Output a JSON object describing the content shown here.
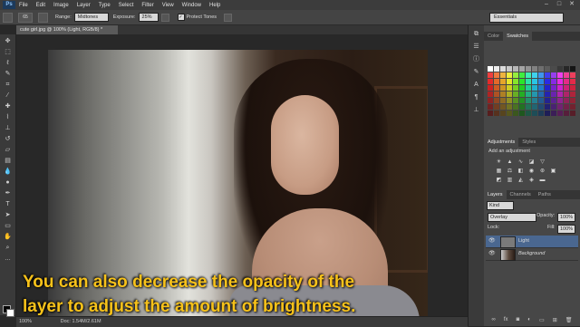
{
  "app": {
    "logo": "Ps",
    "menu": [
      "File",
      "Edit",
      "Image",
      "Layer",
      "Type",
      "Select",
      "Filter",
      "View",
      "Window",
      "Help"
    ]
  },
  "options": {
    "brush_size": "65",
    "range_label": "Range:",
    "range_value": "Midtones",
    "exposure_label": "Exposure:",
    "exposure_value": "25%",
    "protect_label": "Protect Tones",
    "workspace": "Essentials"
  },
  "document": {
    "tab": "cute girl.jpg @ 100% (Light, RGB/8) *",
    "zoom": "100%",
    "doc_info": "Doc: 1.54M/2.61M"
  },
  "caption": {
    "line1": "You can also decrease the opacity of the",
    "line2": "layer to adjust the amount of brightness."
  },
  "panels": {
    "color_tabs": [
      "Color",
      "Swatches"
    ],
    "adjust_tabs": [
      "Adjustments",
      "Styles"
    ],
    "adjust_title": "Add an adjustment",
    "layers_tabs": [
      "Layers",
      "Channels",
      "Paths"
    ],
    "kind_label": "Kind",
    "blend_mode": "Overlay",
    "opacity_label": "Opacity:",
    "opacity_value": "100%",
    "lock_label": "Lock:",
    "fill_label": "Fill:",
    "fill_value": "100%",
    "layers": [
      {
        "name": "Light",
        "selected": true
      },
      {
        "name": "Background",
        "selected": false
      }
    ]
  },
  "colors": {
    "accent": "#f7c21a",
    "selection": "#4a6790"
  }
}
